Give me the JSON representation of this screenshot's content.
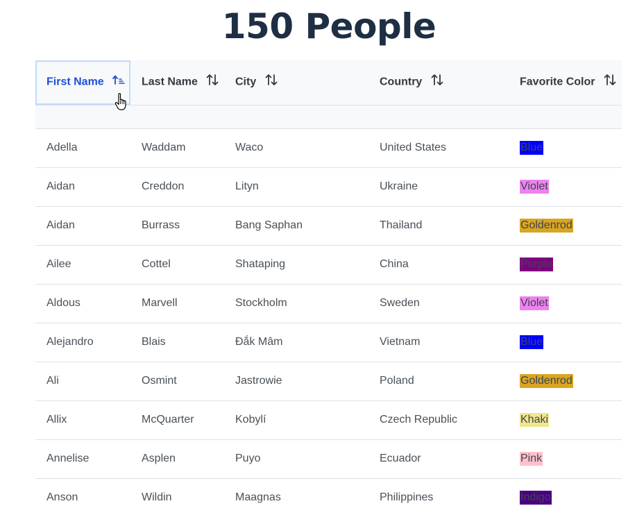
{
  "title": "150 People",
  "table": {
    "columns": [
      {
        "label": "First Name",
        "sorted": true
      },
      {
        "label": "Last Name",
        "sorted": false
      },
      {
        "label": "City",
        "sorted": false
      },
      {
        "label": "Country",
        "sorted": false
      },
      {
        "label": "Favorite Color",
        "sorted": false
      }
    ],
    "rows": [
      {
        "first": "Adella",
        "last": "Waddam",
        "city": "Waco",
        "country": "United States",
        "color": "Blue",
        "bg": "#0000ff"
      },
      {
        "first": "Aidan",
        "last": "Creddon",
        "city": "Lityn",
        "country": "Ukraine",
        "color": "Violet",
        "bg": "#ee82ee"
      },
      {
        "first": "Aidan",
        "last": "Burrass",
        "city": "Bang Saphan",
        "country": "Thailand",
        "color": "Goldenrod",
        "bg": "#daa520"
      },
      {
        "first": "Ailee",
        "last": "Cottel",
        "city": "Shataping",
        "country": "China",
        "color": "Purple",
        "bg": "#800080"
      },
      {
        "first": "Aldous",
        "last": "Marvell",
        "city": "Stockholm",
        "country": "Sweden",
        "color": "Violet",
        "bg": "#ee82ee"
      },
      {
        "first": "Alejandro",
        "last": "Blais",
        "city": "Đắk Mâm",
        "country": "Vietnam",
        "color": "Blue",
        "bg": "#0000ff"
      },
      {
        "first": "Ali",
        "last": "Osmint",
        "city": "Jastrowie",
        "country": "Poland",
        "color": "Goldenrod",
        "bg": "#daa520"
      },
      {
        "first": "Allix",
        "last": "McQuarter",
        "city": "Kobylí",
        "country": "Czech Republic",
        "color": "Khaki",
        "bg": "#f0e68c"
      },
      {
        "first": "Annelise",
        "last": "Asplen",
        "city": "Puyo",
        "country": "Ecuador",
        "color": "Pink",
        "bg": "#ffc0cb"
      },
      {
        "first": "Anson",
        "last": "Wildin",
        "city": "Maagnas",
        "country": "Philippines",
        "color": "Indigo",
        "bg": "#4b0082"
      }
    ]
  },
  "icons": {
    "sorted_column": "sort-amount-up-icon",
    "unsorted_column": "sort-arrows-icon",
    "pointer": "hand-pointer-cursor-icon"
  },
  "colors": {
    "title": "#1e2f44",
    "header_bg": "#f8f9fa",
    "sorted_header_text": "#1d4ed8",
    "border": "#dee2e6",
    "cell_text": "#495057"
  }
}
